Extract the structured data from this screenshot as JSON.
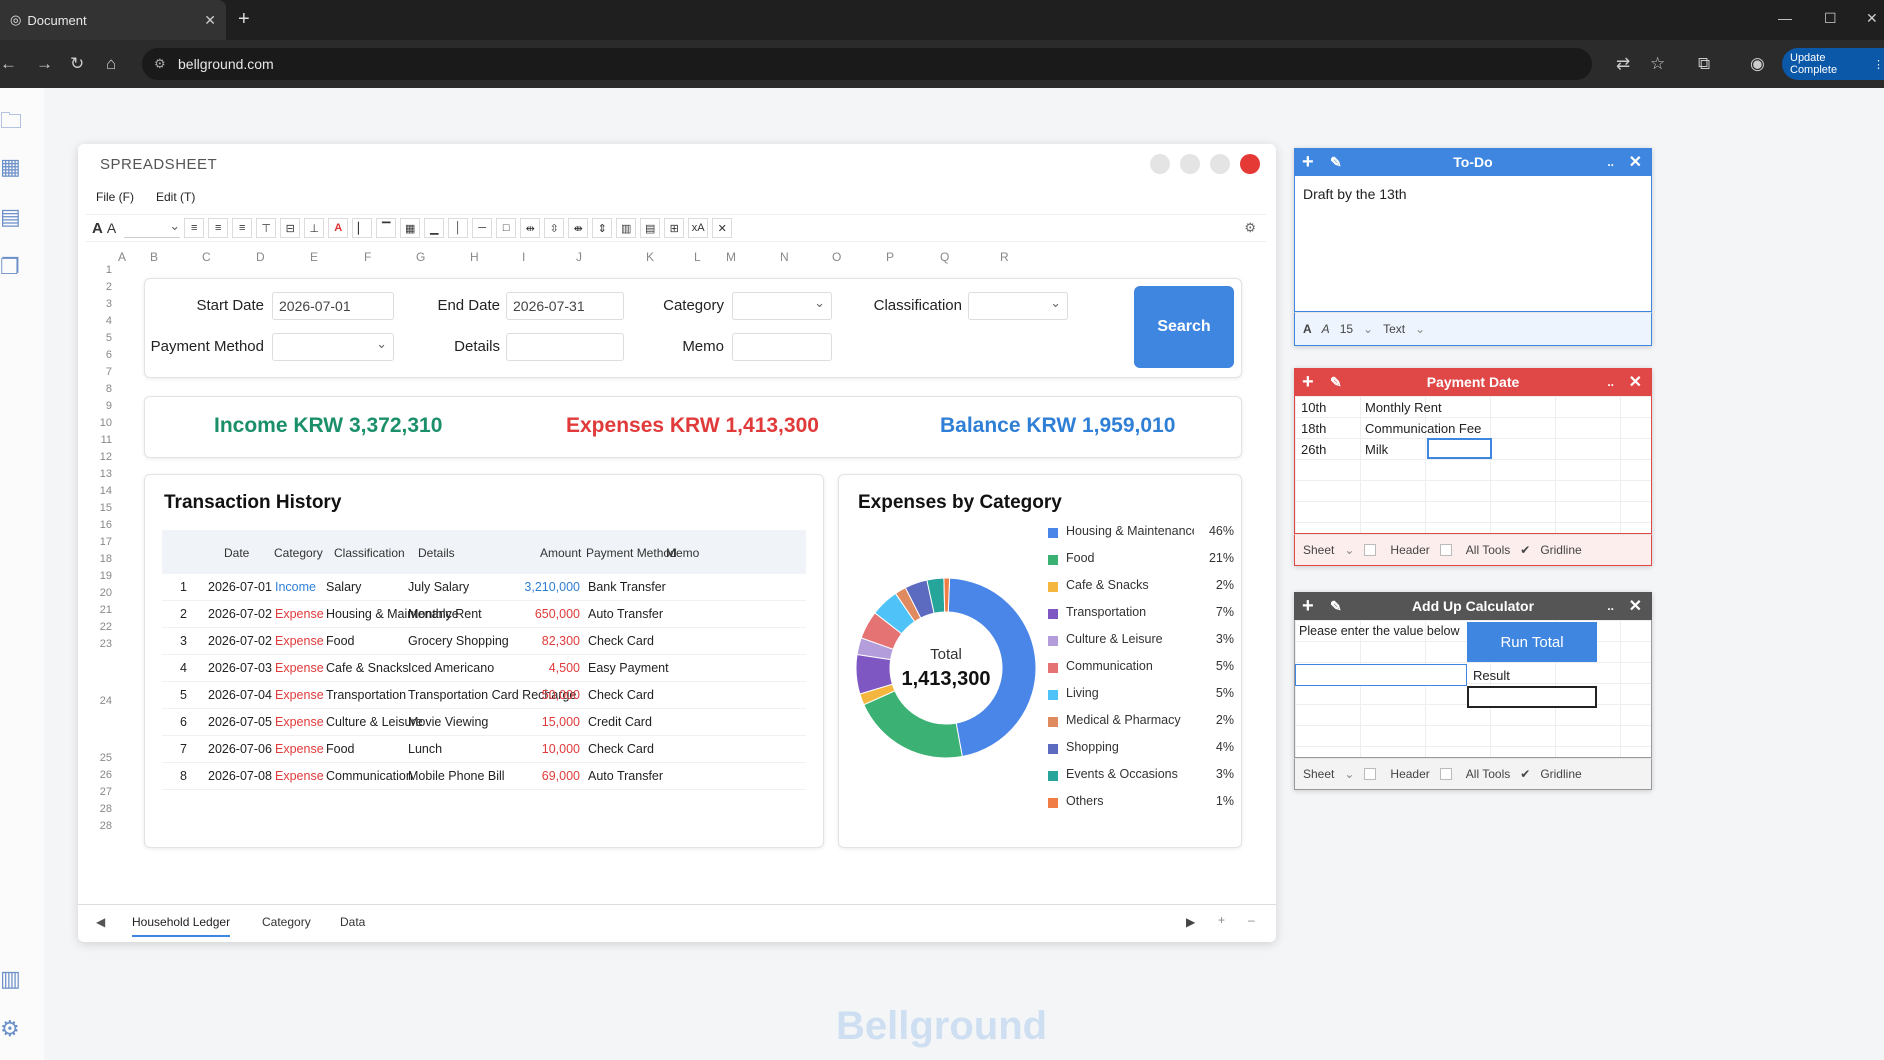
{
  "browser": {
    "tab_title": "Document",
    "url": "bellground.com",
    "update_label": "Update Complete"
  },
  "app": {
    "title": "SPREADSHEET",
    "menu": [
      "File (F)",
      "Edit (T)"
    ],
    "columns": [
      "A",
      "B",
      "C",
      "D",
      "E",
      "F",
      "G",
      "H",
      "I",
      "J",
      "K",
      "L",
      "M",
      "N",
      "O",
      "P",
      "Q",
      "R"
    ],
    "row_numbers": [
      "1",
      "2",
      "3",
      "4",
      "5",
      "6",
      "7",
      "8",
      "9",
      "10",
      "11",
      "12",
      "13",
      "14",
      "15",
      "16",
      "17",
      "18",
      "19",
      "20",
      "21",
      "22",
      "23",
      "24",
      "25",
      "26",
      "27",
      "28",
      "28"
    ],
    "sheet_tabs": [
      "Household Ledger",
      "Category",
      "Data"
    ],
    "watermark": "Bellground"
  },
  "filters": {
    "start_date_label": "Start Date",
    "start_date": "2026-07-01",
    "end_date_label": "End Date",
    "end_date": "2026-07-31",
    "category_label": "Category",
    "classification_label": "Classification",
    "payment_method_label": "Payment Method",
    "details_label": "Details",
    "memo_label": "Memo",
    "search_label": "Search"
  },
  "summary": {
    "income": "Income KRW 3,372,310",
    "expenses": "Expenses KRW 1,413,300",
    "balance": "Balance KRW 1,959,010",
    "income_color": "#1a8f6a",
    "expense_color": "#e03a3a",
    "balance_color": "#2f7fd6"
  },
  "transactions": {
    "title": "Transaction History",
    "headers": [
      "Date",
      "Category",
      "Classification",
      "Details",
      "Amount",
      "Payment Method",
      "Memo"
    ],
    "rows": [
      {
        "n": "1",
        "date": "2026-07-01",
        "category": "Income",
        "classification": "Salary",
        "details": "July Salary",
        "amount": "3,210,000",
        "method": "Bank Transfer"
      },
      {
        "n": "2",
        "date": "2026-07-02",
        "category": "Expense",
        "classification": "Housing & Maintenance",
        "details": "Monthly Rent",
        "amount": "650,000",
        "method": "Auto Transfer"
      },
      {
        "n": "3",
        "date": "2026-07-02",
        "category": "Expense",
        "classification": "Food",
        "details": "Grocery Shopping",
        "amount": "82,300",
        "method": "Check Card"
      },
      {
        "n": "4",
        "date": "2026-07-03",
        "category": "Expense",
        "classification": "Cafe & Snacks",
        "details": "Iced Americano",
        "amount": "4,500",
        "method": "Easy Payment"
      },
      {
        "n": "5",
        "date": "2026-07-04",
        "category": "Expense",
        "classification": "Transportation",
        "details": "Transportation Card Recharge",
        "amount": "50,000",
        "method": "Check Card"
      },
      {
        "n": "6",
        "date": "2026-07-05",
        "category": "Expense",
        "classification": "Culture & Leisure",
        "details": "Movie Viewing",
        "amount": "15,000",
        "method": "Credit Card"
      },
      {
        "n": "7",
        "date": "2026-07-06",
        "category": "Expense",
        "classification": "Food",
        "details": "Lunch",
        "amount": "10,000",
        "method": "Check Card"
      },
      {
        "n": "8",
        "date": "2026-07-08",
        "category": "Expense",
        "classification": "Communication",
        "details": "Mobile Phone Bill",
        "amount": "69,000",
        "method": "Auto Transfer"
      }
    ]
  },
  "chart_data": {
    "type": "pie",
    "title": "Expenses by Category",
    "center_label": "Total",
    "center_value": "1,413,300",
    "categories": [
      "Housing & Maintenance",
      "Food",
      "Cafe & Snacks",
      "Transportation",
      "Culture & Leisure",
      "Communication",
      "Living",
      "Medical & Pharmacy",
      "Shopping",
      "Events & Occasions",
      "Others"
    ],
    "values": [
      46,
      21,
      2,
      7,
      3,
      5,
      5,
      2,
      4,
      3,
      1
    ],
    "labels": [
      "46%",
      "21%",
      "2%",
      "7%",
      "3%",
      "5%",
      "5%",
      "2%",
      "4%",
      "3%",
      "1%"
    ],
    "colors": [
      "#4a86e8",
      "#3bb273",
      "#f4b63f",
      "#7e57c2",
      "#b39ddb",
      "#e57373",
      "#4fc3f7",
      "#e08a5f",
      "#5c6bc0",
      "#26a69a",
      "#ef7d45"
    ],
    "legend": "right"
  },
  "todo": {
    "title": "To-Do",
    "text": "Draft by the 13th",
    "font_size": "15",
    "style": "Text",
    "head_color": "#3e86e0"
  },
  "payment": {
    "title": "Payment Date",
    "rows": [
      [
        "10th",
        "Monthly Rent"
      ],
      [
        "18th",
        "Communication Fee"
      ],
      [
        "26th",
        "Milk"
      ]
    ],
    "head_color": "#e04848"
  },
  "calculator": {
    "title": "Add Up Calculator",
    "prompt": "Please enter the value below",
    "run_label": "Run Total",
    "result_label": "Result",
    "head_color": "#555555"
  },
  "widget_footer": {
    "sheet": "Sheet",
    "header": "Header",
    "all_tools": "All Tools",
    "gridline": "Gridline"
  }
}
